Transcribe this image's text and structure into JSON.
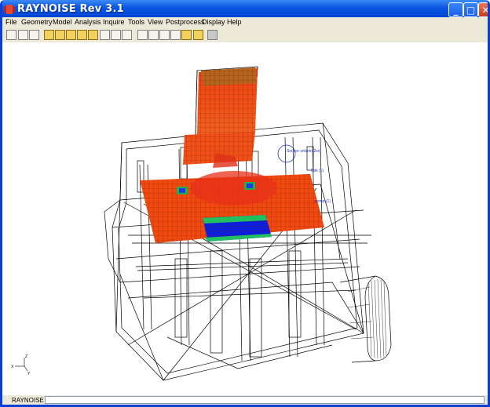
{
  "window": {
    "title": "RAYNOISE Rev 3.1"
  },
  "title_buttons": {
    "minimize": "_",
    "maximize": "□",
    "close": "✕"
  },
  "menu": [
    {
      "label": "File"
    },
    {
      "label": "Geometry"
    },
    {
      "label": "Model"
    },
    {
      "label": "Analysis"
    },
    {
      "label": "Inquire"
    },
    {
      "label": "Tools"
    },
    {
      "label": "View"
    },
    {
      "label": "Postprocess"
    },
    {
      "label": "Display"
    },
    {
      "label": "Help"
    }
  ],
  "viewport": {
    "annotations": {
      "source": "Source volvolo(2ss)",
      "label2": "Spk (1)",
      "label3": "pomp (1)"
    },
    "axis": {
      "x": "X",
      "y": "Y",
      "z": "Z"
    }
  },
  "status": {
    "label": "RAYNOISE"
  }
}
